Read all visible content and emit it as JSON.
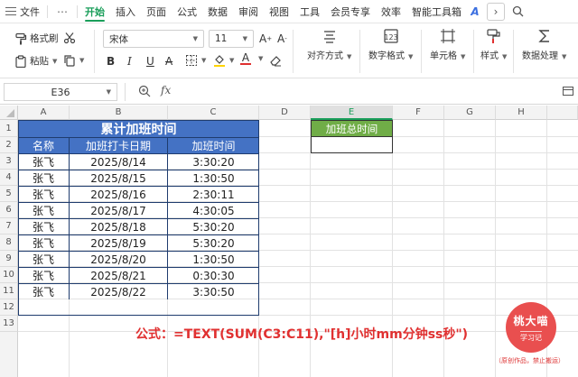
{
  "menu": {
    "items": [
      "文件",
      "开始",
      "插入",
      "页面",
      "公式",
      "数据",
      "审阅",
      "视图",
      "工具",
      "会员专享",
      "效率",
      "智能工具箱"
    ],
    "active": "开始",
    "more_label": "⋯"
  },
  "ribbon": {
    "format_painter": "格式刷",
    "paste": "粘贴",
    "font_name": "宋体",
    "font_size": "11",
    "align_label": "对齐方式",
    "number_format_label": "数字格式",
    "cell_label": "单元格",
    "style_label": "样式",
    "data_process_label": "数据处理"
  },
  "formula_bar": {
    "name_box": "E36",
    "fx": "fx",
    "formula": ""
  },
  "columns": [
    "A",
    "B",
    "C",
    "D",
    "E",
    "F",
    "G",
    "H"
  ],
  "rows": [
    "1",
    "2",
    "3",
    "4",
    "5",
    "6",
    "7",
    "8",
    "9",
    "10",
    "11",
    "12",
    "13"
  ],
  "table": {
    "title": "累计加班时间",
    "headers": [
      "名称",
      "加班打卡日期",
      "加班时间"
    ],
    "records": [
      [
        "张飞",
        "2025/8/14",
        "3:30:20"
      ],
      [
        "张飞",
        "2025/8/15",
        "1:30:50"
      ],
      [
        "张飞",
        "2025/8/16",
        "2:30:11"
      ],
      [
        "张飞",
        "2025/8/17",
        "4:30:05"
      ],
      [
        "张飞",
        "2025/8/18",
        "5:30:20"
      ],
      [
        "张飞",
        "2025/8/19",
        "5:30:20"
      ],
      [
        "张飞",
        "2025/8/20",
        "1:30:50"
      ],
      [
        "张飞",
        "2025/8/21",
        "0:30:30"
      ],
      [
        "张飞",
        "2025/8/22",
        "3:30:50"
      ]
    ]
  },
  "summary": {
    "header": "加班总时间",
    "value": ""
  },
  "formula_note": "公式：=TEXT(SUM(C3:C11),\"[h]小时mm分钟ss秒\")",
  "logo": {
    "line1": "桃大喵",
    "line2": "学习记",
    "watermark": "（原创作品，禁止搬运）"
  },
  "colors": {
    "accent": "#1a9e5a",
    "table_header": "#4472c4",
    "summary_header": "#70ad47",
    "formula_text": "#e03030",
    "logo": "#e94f4f"
  }
}
